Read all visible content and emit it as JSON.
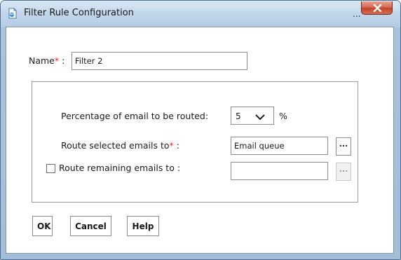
{
  "window": {
    "title": "Filter Rule Configuration",
    "title_overflow": "...",
    "icon": "app-page-icon",
    "close_icon": "close-icon"
  },
  "form": {
    "name": {
      "label": "Name",
      "required_mark": "*",
      "separator": " :",
      "value": "Filter 2"
    },
    "percentage": {
      "label": "Percentage of email to be routed:",
      "selected": "5",
      "unit": "%"
    },
    "route_selected": {
      "label": "Route selected emails to",
      "required_mark": "*",
      "separator": " :",
      "value": "Email queue",
      "browse_label": "..."
    },
    "route_remaining": {
      "label": "Route remaining emails to :",
      "checked": false,
      "value": "",
      "browse_label": "..."
    }
  },
  "buttons": {
    "ok": "OK",
    "cancel": "Cancel",
    "help": "Help"
  },
  "colors": {
    "required": "#e0242e",
    "title_bar": "#c2d6ea",
    "close_button": "#c4442b"
  }
}
